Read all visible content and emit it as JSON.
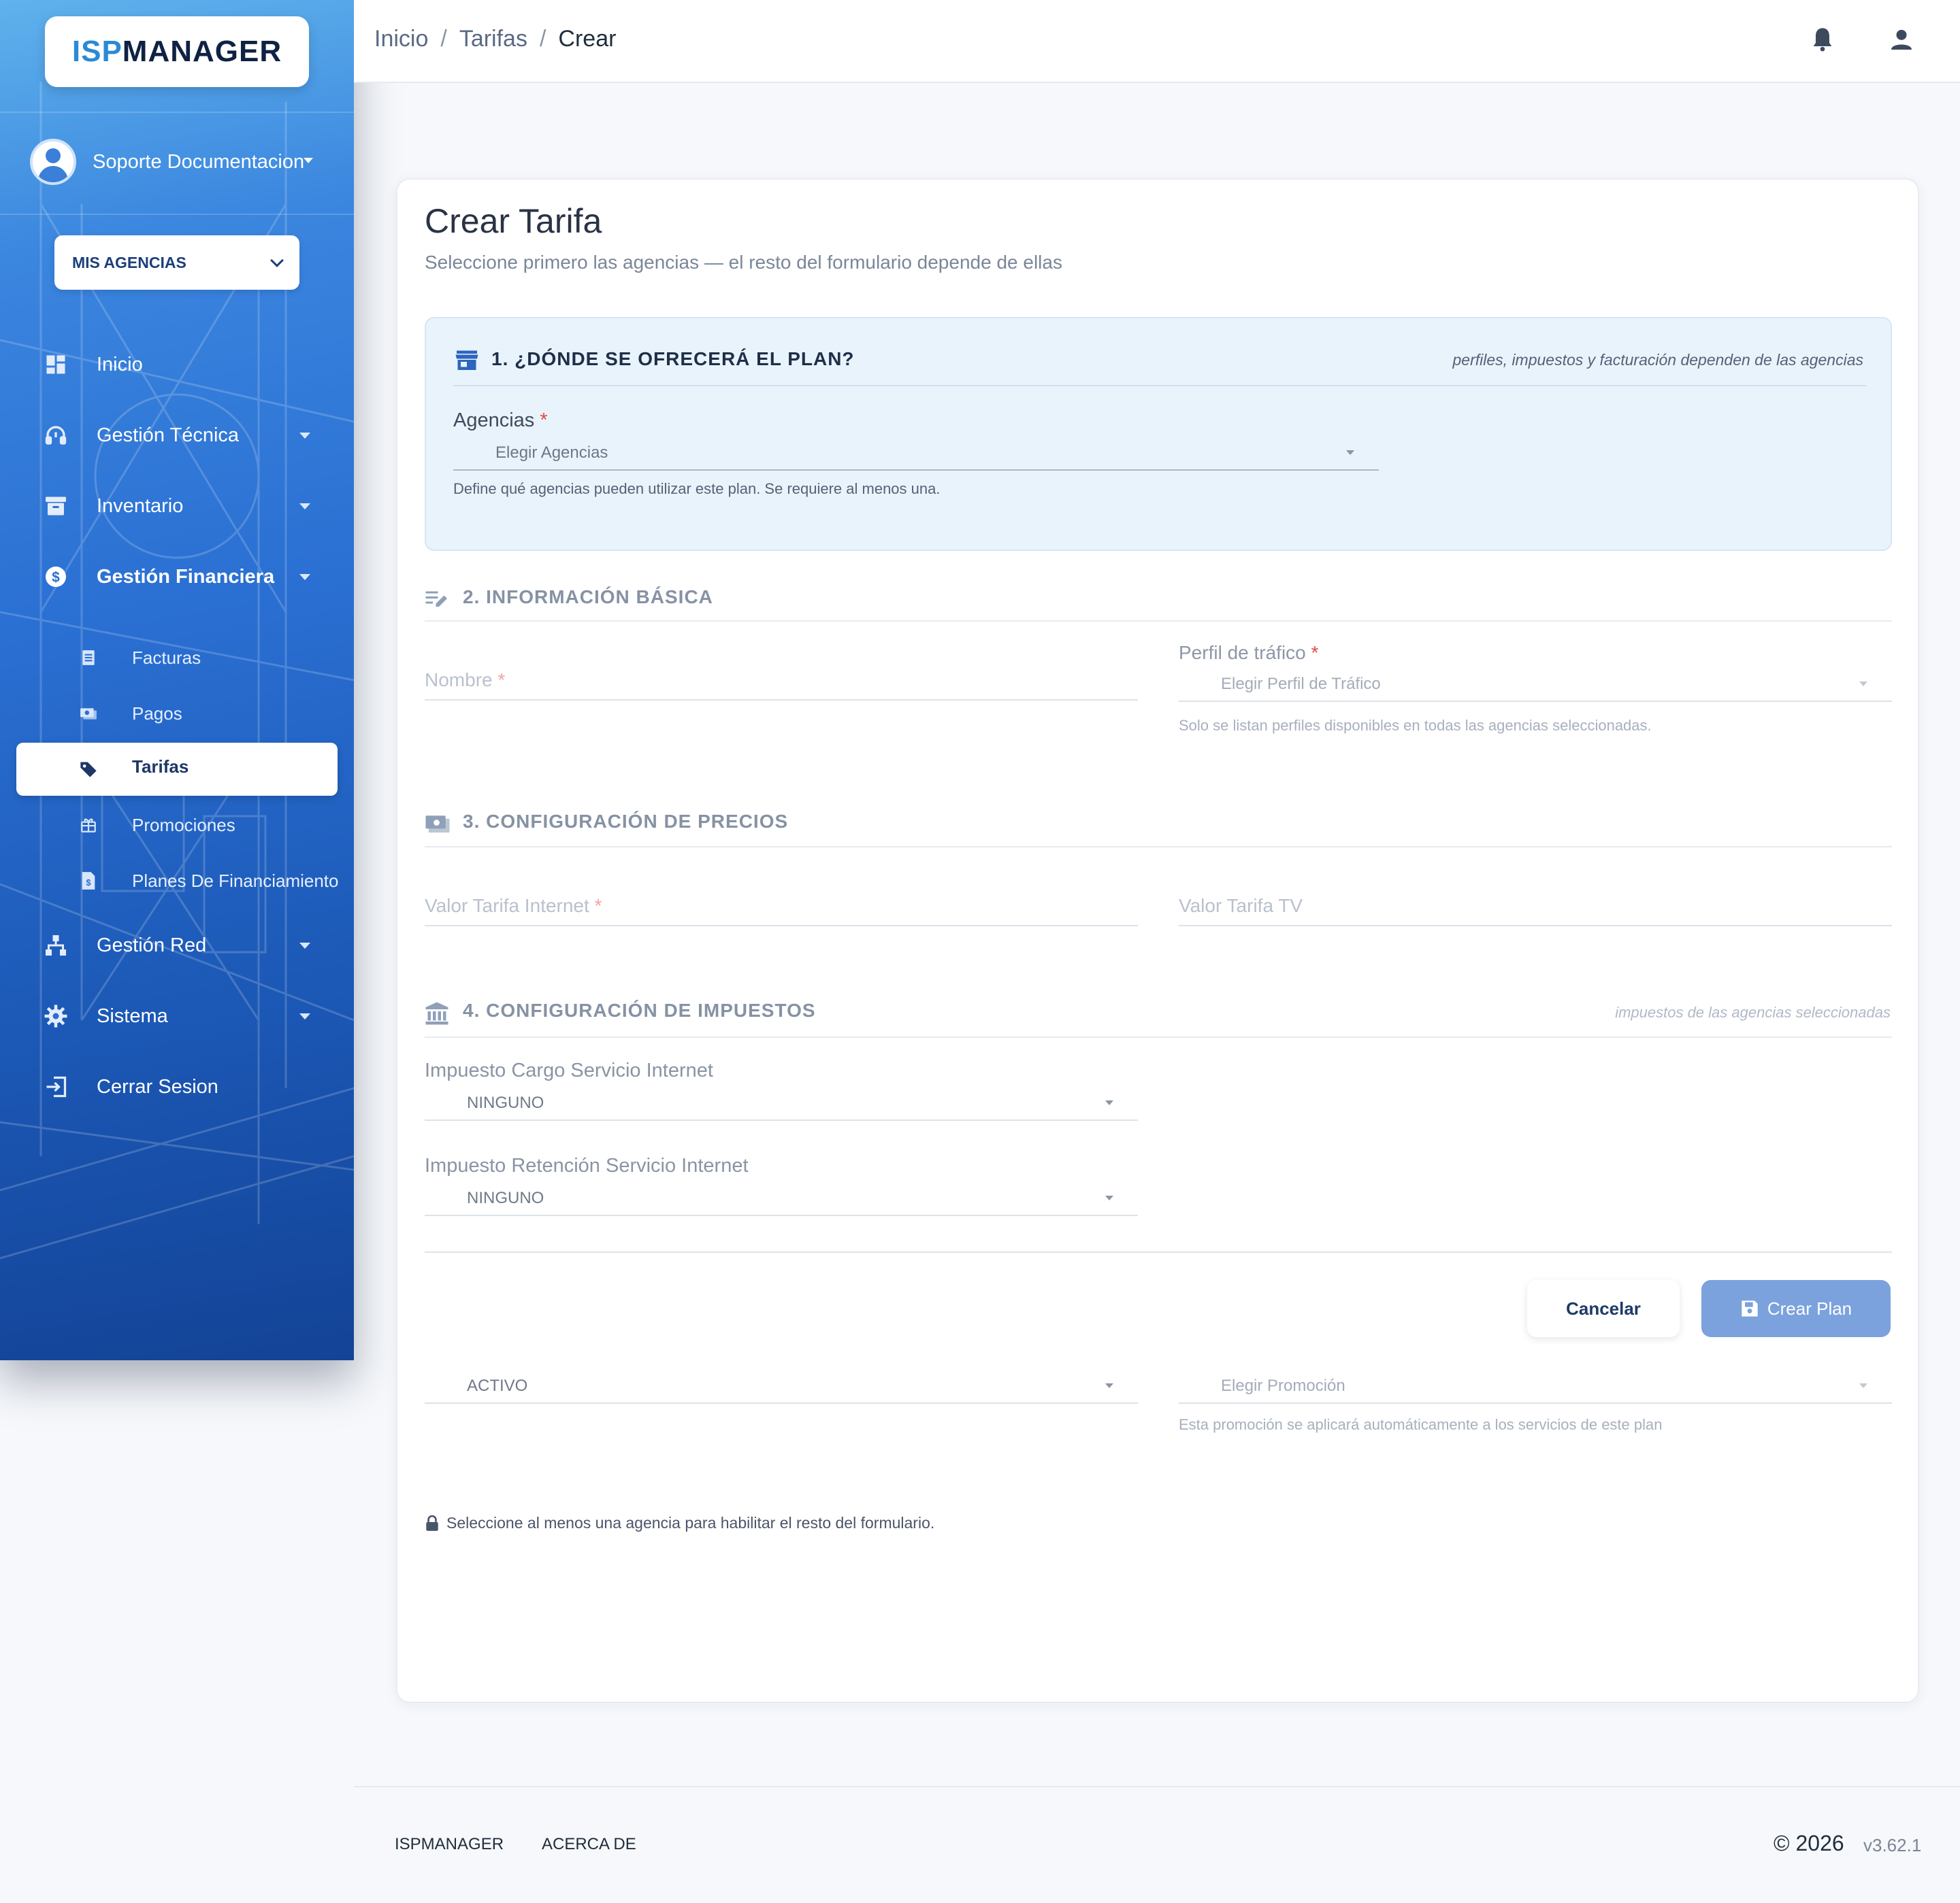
{
  "brand": {
    "logo_isp": "ISP",
    "logo_manager": "MANAGER"
  },
  "sidebar": {
    "user_name": "Soporte Documentacion",
    "agencias_button": "MIS AGENCIAS",
    "items": [
      {
        "label": "Inicio",
        "icon": "dashboard-icon",
        "has_caret": false
      },
      {
        "label": "Gestión Técnica",
        "icon": "headset-icon",
        "has_caret": true
      },
      {
        "label": "Inventario",
        "icon": "archive-icon",
        "has_caret": true
      },
      {
        "label": "Gestión Financiera",
        "icon": "dollar-icon",
        "has_caret": true
      },
      {
        "label": "Gestión Red",
        "icon": "network-icon",
        "has_caret": true
      },
      {
        "label": "Sistema",
        "icon": "gear-icon",
        "has_caret": true
      },
      {
        "label": "Cerrar Sesion",
        "icon": "logout-icon",
        "has_caret": false
      }
    ],
    "sub_items": [
      {
        "label": "Facturas",
        "icon": "invoice-icon"
      },
      {
        "label": "Pagos",
        "icon": "payments-icon"
      },
      {
        "label": "Tarifas",
        "icon": "tag-icon",
        "active": true
      },
      {
        "label": "Promociones",
        "icon": "gift-icon"
      },
      {
        "label": "Planes De Financiamiento",
        "icon": "finance-doc-icon"
      }
    ]
  },
  "topbar": {
    "breadcrumb": [
      "Inicio",
      "Tarifas",
      "Crear"
    ],
    "separator": "/"
  },
  "form": {
    "title": "Crear Tarifa",
    "subtitle": "Seleccione primero las agencias — el resto del formulario depende de ellas",
    "section1": {
      "title": "1. ¿DÓNDE SE OFRECERÁ EL PLAN?",
      "note": "perfiles, impuestos y facturación dependen de las agencias",
      "agencias_label": "Agencias",
      "agencias_placeholder": "Elegir Agencias",
      "agencias_helper": "Define qué agencias pueden utilizar este plan. Se requiere al menos una."
    },
    "section2": {
      "title": "2. INFORMACIÓN BÁSICA",
      "nombre_label": "Nombre",
      "perfil_label": "Perfil de tráfico",
      "perfil_placeholder": "Elegir Perfil de Tráfico",
      "perfil_helper": "Solo se listan perfiles disponibles en todas las agencias seleccionadas."
    },
    "section3": {
      "title": "3. CONFIGURACIÓN DE PRECIOS",
      "internet_label": "Valor Tarifa Internet",
      "tv_label": "Valor Tarifa TV"
    },
    "section4": {
      "title": "4. CONFIGURACIÓN DE IMPUESTOS",
      "note": "impuestos de las agencias seleccionadas",
      "cargo_label": "Impuesto Cargo Servicio Internet",
      "cargo_value": "NINGUNO",
      "retencion_label": "Impuesto Retención Servicio Internet",
      "retencion_value": "NINGUNO"
    },
    "estado_value": "ACTIVO",
    "promocion_placeholder": "Elegir Promoción",
    "promocion_helper": "Esta promoción se aplicará automáticamente a los servicios de este plan",
    "cancel_label": "Cancelar",
    "submit_label": "Crear Plan",
    "lock_note": "Seleccione al menos una agencia para habilitar el resto del formulario."
  },
  "footer": {
    "link1": "ISPMANAGER",
    "link2": "ACERCA DE",
    "copyright": "© 2026",
    "version": "v3.62.1"
  },
  "colors": {
    "sidebar_top": "#5fb2ec",
    "sidebar_bottom": "#134396",
    "primary_button": "#7ba2dc",
    "section_bg": "#e9f3fc",
    "required": "#e14a4a"
  }
}
